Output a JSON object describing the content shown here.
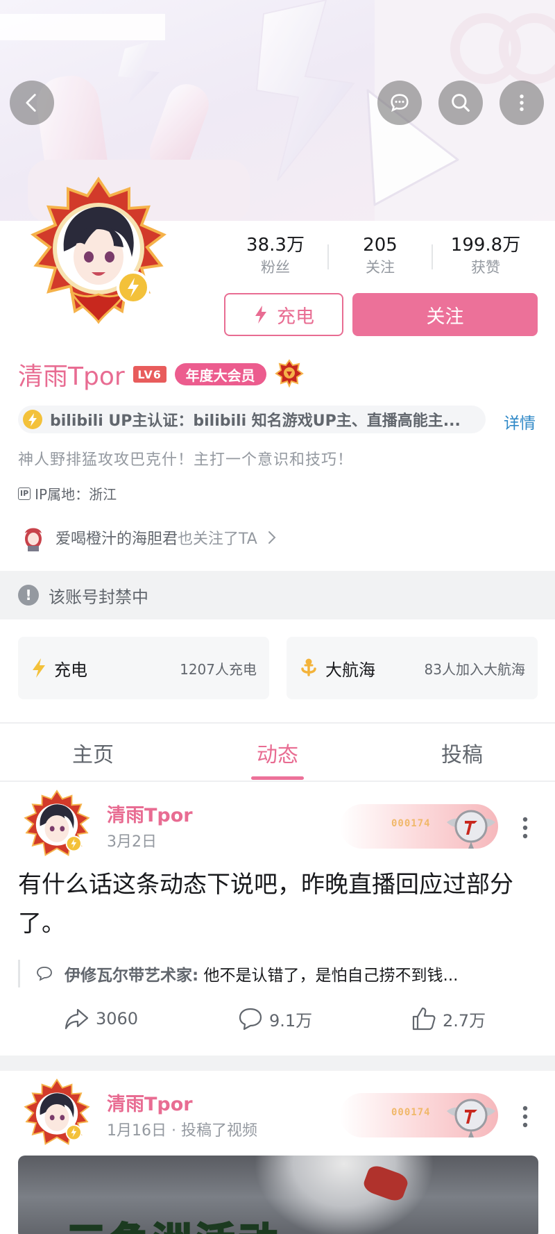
{
  "header": {
    "back_label": "back",
    "icons": [
      "back-arrow-icon",
      "chat-bubble-icon",
      "search-icon",
      "more-vertical-icon"
    ]
  },
  "profile": {
    "stats": [
      {
        "value": "38.3万",
        "label": "粉丝"
      },
      {
        "value": "205",
        "label": "关注"
      },
      {
        "value": "199.8万",
        "label": "获赞"
      }
    ],
    "charge_button": "充电",
    "follow_button": "关注",
    "username": "清雨Tpor",
    "level_badge": "LV6",
    "vip_badge": "年度大会员",
    "certification": "bilibili UP主认证：bilibili 知名游戏UP主、直播高能主...",
    "certification_detail": "详情",
    "signature": "神人野排猛攻攻巴克什！主打一个意识和技巧！",
    "ip_icon_text": "IP",
    "ip_location": "IP属地：浙江",
    "also_follow_name": "爱喝橙汁的海胆君",
    "also_follow_tail": "也关注了TA",
    "banned_notice": "该账号封禁中"
  },
  "cards": [
    {
      "title": "充电",
      "subtitle": "1207人充电",
      "icon": "lightning-icon"
    },
    {
      "title": "大航海",
      "subtitle": "83人加入大航海",
      "icon": "anchor-icon"
    }
  ],
  "tabs": [
    {
      "label": "主页",
      "active": false
    },
    {
      "label": "动态",
      "active": true
    },
    {
      "label": "投稿",
      "active": false
    }
  ],
  "posts": [
    {
      "author": "清雨Tpor",
      "meta": "3月2日",
      "fan_number": "000174",
      "text": "有什么话这条动态下说吧，昨晚直播回应过部分了。",
      "comment_author": "伊修瓦尔带艺术家:",
      "comment_text": " 他不是认错了，是怕自己捞不到钱...",
      "shares": "3060",
      "comments": "9.1万",
      "likes": "2.7万"
    },
    {
      "author": "清雨Tpor",
      "meta": "1月16日 · 投稿了视频",
      "fan_number": "000174",
      "video_title": "三角洲活动"
    }
  ],
  "colors": {
    "accent_pink": "#ec7199",
    "link_blue": "#2f88c7",
    "text_gray": "#61666d",
    "muted_gray": "#9499a0"
  }
}
